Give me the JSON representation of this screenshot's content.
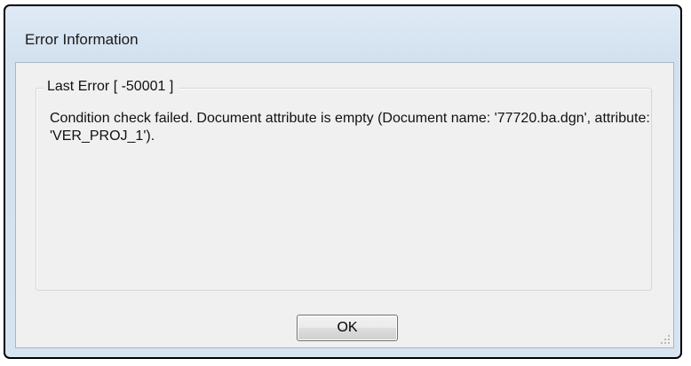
{
  "window": {
    "title": "Error Information"
  },
  "group": {
    "label": "Last Error [ -50001 ]"
  },
  "message": {
    "text": "Condition check failed. Document attribute is empty (Document name: '77720.ba.dgn', attribute: 'VER_PROJ_1')."
  },
  "buttons": {
    "ok_label": "OK"
  },
  "icons": {
    "resize_grip": "resize-grip-icon"
  }
}
